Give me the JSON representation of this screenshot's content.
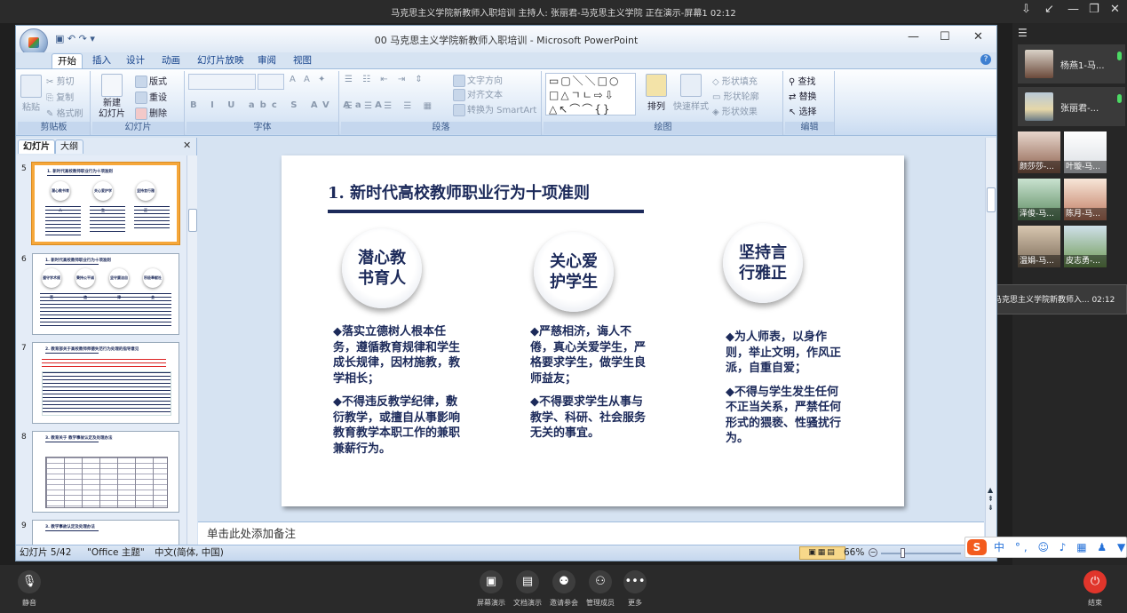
{
  "meeting": {
    "title_bar": "马克思主义学院新教师入职培训  主持人: 张丽君-马克思主义学院  正在演示-屏幕1  02:12",
    "participants_big": [
      {
        "name": "杨燕1-马...",
        "mic": "on"
      },
      {
        "name": "张丽君-...",
        "mic": "on"
      }
    ],
    "participants_tiles": [
      "颜莎莎-...",
      "叶璇-马...",
      "泽俊-马...",
      "陈月-马...",
      "温娟-马...",
      "皮志勇-..."
    ],
    "tooltip": "马克思主义学院新教师入... 02:12",
    "bottom_buttons": [
      {
        "label": "静音",
        "icon": "mic-icon"
      },
      {
        "label": "屏幕演示",
        "icon": "screen-share-icon"
      },
      {
        "label": "文档演示",
        "icon": "document-icon"
      },
      {
        "label": "邀请参会",
        "icon": "invite-icon"
      },
      {
        "label": "管理成员",
        "icon": "members-icon"
      },
      {
        "label": "更多",
        "icon": "more-icon"
      },
      {
        "label": "结束",
        "icon": "power-icon"
      }
    ]
  },
  "ppt": {
    "window_title": "00 马克思主义学院新教师入职培训 - Microsoft PowerPoint",
    "tabs": [
      "开始",
      "插入",
      "设计",
      "动画",
      "幻灯片放映",
      "审阅",
      "视图"
    ],
    "groups": {
      "clipboard": {
        "label": "剪贴板",
        "paste": "粘贴",
        "cut": "剪切",
        "copy": "复制",
        "format": "格式刷"
      },
      "slides": {
        "label": "幻灯片",
        "new": "新建",
        "new2": "幻灯片",
        "layout": "版式",
        "reset": "重设",
        "delete": "删除"
      },
      "font": {
        "label": "字体"
      },
      "paragraph": {
        "label": "段落",
        "dir": "文字方向",
        "align": "对齐文本",
        "smart": "转换为 SmartArt"
      },
      "drawing": {
        "label": "绘图",
        "arrange": "排列",
        "quick": "快速样式",
        "fill": "形状填充",
        "outline": "形状轮廓",
        "effect": "形状效果"
      },
      "edit": {
        "label": "编辑",
        "find": "查找",
        "replace": "替换",
        "select": "选择"
      }
    },
    "pane_tabs": [
      "幻灯片",
      "大纲"
    ],
    "thumbnails": [
      {
        "num": "5",
        "title": "1. 新时代高校教师职业行为十项准则",
        "circles": [
          "潜心教书育人",
          "关心爱护学生",
          "坚持言行雅正"
        ]
      },
      {
        "num": "6",
        "title": "1. 新时代高校教师职业行为十项准则",
        "circles": [
          "遵守学术规范",
          "秉持公平诚信",
          "坚守廉洁自律",
          "积极奉献社会"
        ]
      },
      {
        "num": "7",
        "title": "2. 教育部关于高校教师师德失范行为处理的指导意见"
      },
      {
        "num": "8",
        "title": "3. 教育关于 教学事故认定及处理办法"
      },
      {
        "num": "9",
        "title": "3. 教学事故认定及处理办法"
      }
    ],
    "slide": {
      "title": "1. 新时代高校教师职业行为十项准则",
      "columns": [
        {
          "heading": [
            "潜心教",
            "书育人"
          ],
          "bullets": [
            "◆落实立德树人根本任务，遵循教育规律和学生成长规律，因材施教，教学相长；",
            "◆不得违反教学纪律，敷衍教学，或擅自从事影响教育教学本职工作的兼职兼薪行为。"
          ]
        },
        {
          "heading": [
            "关心爱",
            "护学生"
          ],
          "bullets": [
            "◆严慈相济，诲人不倦，真心关爱学生，严格要求学生，做学生良师益友；",
            "◆不得要求学生从事与教学、科研、社会服务无关的事宜。"
          ]
        },
        {
          "heading": [
            "坚持言",
            "行雅正"
          ],
          "bullets": [
            "◆为人师表，以身作则，举止文明，作风正派，自重自爱；",
            "◆不得与学生发生任何不正当关系，严禁任何形式的猥亵、性骚扰行为。"
          ]
        }
      ]
    },
    "notes_placeholder": "单击此处添加备注",
    "status": {
      "slide": "幻灯片 5/42",
      "theme": "\"Office 主题\"",
      "lang": "中文(简体, 中国)",
      "zoom": "66%"
    }
  },
  "ime": {
    "label": "中 °, ☺ ♪ ▦ ♟ ▼ ⁘",
    "logo": "S"
  },
  "colors": {
    "navy": "#1c2a5a",
    "accent": "#f6a73a"
  }
}
